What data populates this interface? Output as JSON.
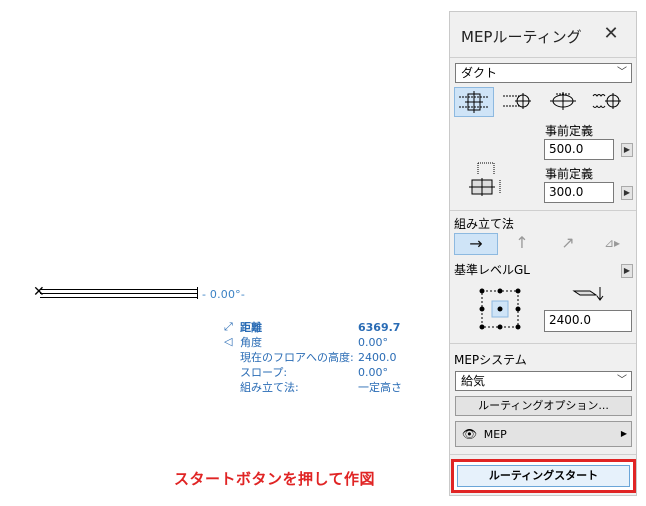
{
  "canvas": {
    "angle_tag": "- 0.00°-",
    "info": {
      "distance_label": "距離",
      "distance_value": "6369.7",
      "angle_label": "角度",
      "angle_value": "0.00°",
      "floor_height_label": "現在のフロアへの高度:",
      "floor_height_value": "2400.0",
      "slope_label": "スロープ:",
      "slope_value": "0.00°",
      "assembly_label": "組み立て法:",
      "assembly_value": "一定高さ"
    },
    "caption": "スタートボタンを押して作図"
  },
  "palette": {
    "title": "MEPルーティング",
    "type_select": "ダクト",
    "predefined_label_1": "事前定義",
    "width_value": "500.0",
    "predefined_label_2": "事前定義",
    "height_value": "300.0",
    "assembly_method_label": "組み立て法",
    "reference_level_label": "基準レベルGL",
    "elevation_value": "2400.0",
    "mep_system_label": "MEPシステム",
    "mep_system_select": "給気",
    "routing_options_button": "ルーティングオプション...",
    "layer_button": "MEP",
    "routing_start_button": "ルーティングスタート"
  }
}
